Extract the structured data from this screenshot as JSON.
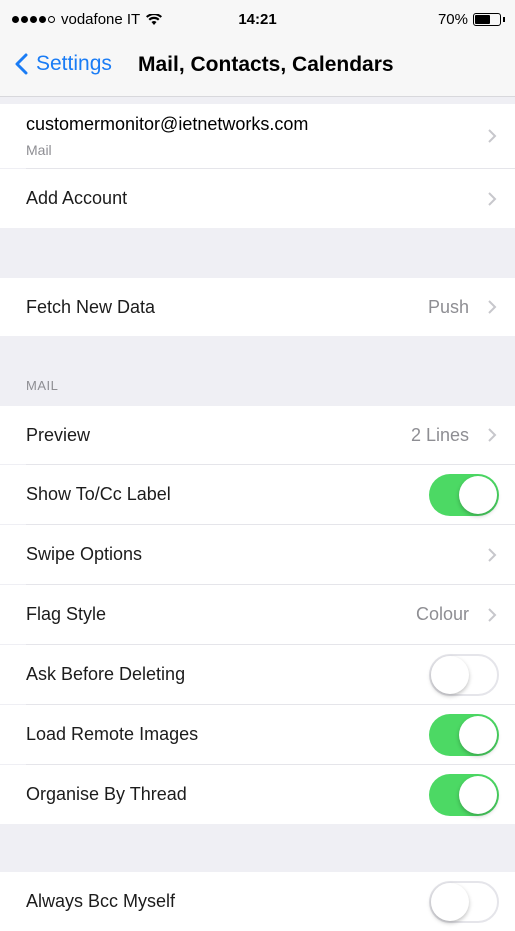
{
  "status": {
    "carrier": "vodafone IT",
    "time": "14:21",
    "battery": "70%",
    "battery_level": 0.7
  },
  "nav": {
    "back_label": "Settings",
    "title": "Mail, Contacts, Calendars"
  },
  "accounts": {
    "email": "customermonitor@ietnetworks.com",
    "email_sub": "Mail",
    "add_account": "Add Account"
  },
  "fetch": {
    "label": "Fetch New Data",
    "value": "Push"
  },
  "mail": {
    "header": "MAIL",
    "preview": {
      "label": "Preview",
      "value": "2 Lines"
    },
    "show_tocc": {
      "label": "Show To/Cc Label",
      "on": true
    },
    "swipe": {
      "label": "Swipe Options"
    },
    "flag": {
      "label": "Flag Style",
      "value": "Colour"
    },
    "ask_delete": {
      "label": "Ask Before Deleting",
      "on": false
    },
    "load_images": {
      "label": "Load Remote Images",
      "on": true
    },
    "organise": {
      "label": "Organise By Thread",
      "on": true
    }
  },
  "composing": {
    "bcc": {
      "label": "Always Bcc Myself",
      "on": false
    }
  },
  "colors": {
    "accent": "#1a7cf5",
    "toggle_on": "#4cd964",
    "background": "#efeff4"
  }
}
